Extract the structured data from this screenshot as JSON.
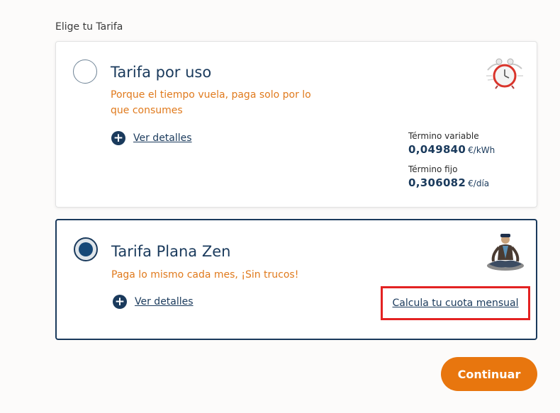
{
  "section_label": "Elige tu Tarifa",
  "tariffs": [
    {
      "title": "Tarifa por uso",
      "description": "Porque el tiempo vuela, paga solo por lo que consumes",
      "details_label": "Ver detalles",
      "selected": false,
      "icon": "alarm-clock-icon",
      "prices": [
        {
          "label": "Término variable",
          "value": "0,049840",
          "unit": "€/kWh"
        },
        {
          "label": "Término fijo",
          "value": "0,306082",
          "unit": "€/día"
        }
      ]
    },
    {
      "title": "Tarifa Plana Zen",
      "description": "Paga lo mismo cada mes, ¡Sin trucos!",
      "details_label": "Ver detalles",
      "selected": true,
      "icon": "meditating-person-icon",
      "quota_link": "Calcula tu cuota mensual"
    }
  ],
  "continue_label": "Continuar",
  "colors": {
    "navy": "#1a3a5c",
    "orange_text": "#e07a1d",
    "button_orange": "#e8760e",
    "highlight_red": "#e32222"
  }
}
